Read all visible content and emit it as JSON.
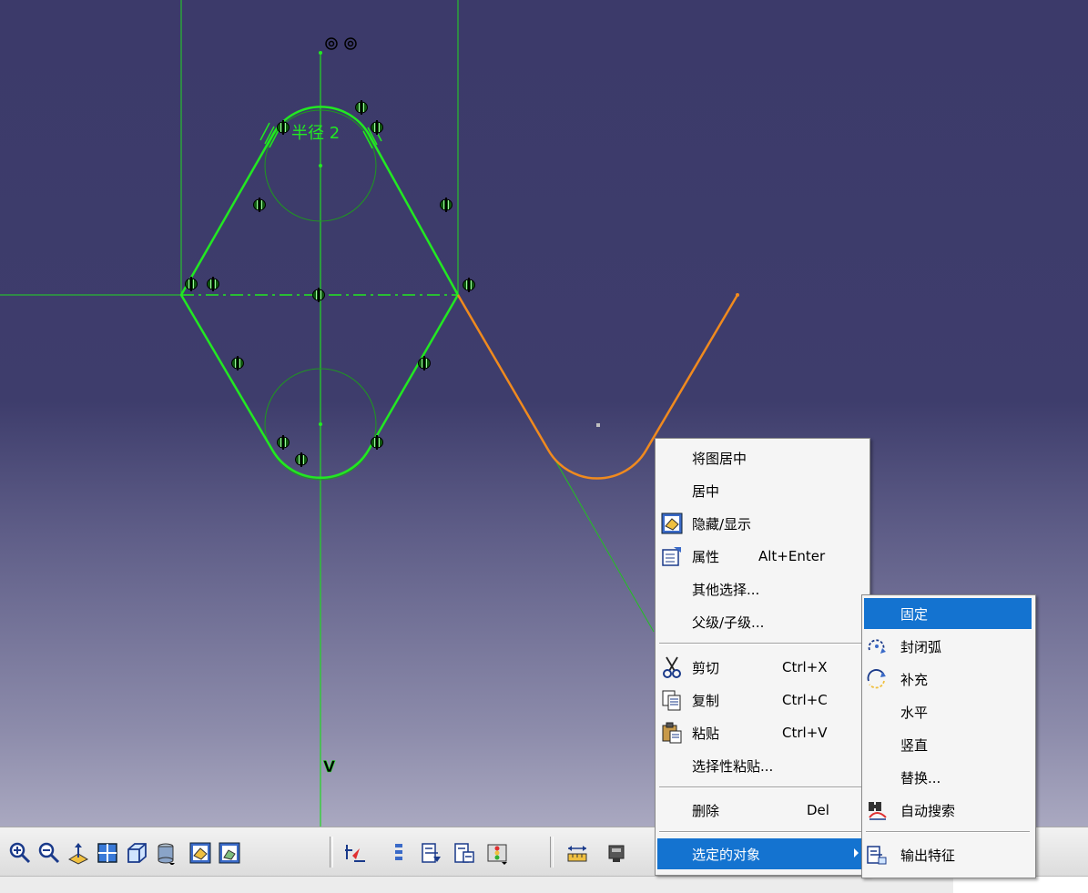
{
  "sketch": {
    "constraint_label": "半径 2",
    "axis_label": "V",
    "colors": {
      "geometry": "#22e822",
      "construction": "#1ea81e",
      "selected_curve": "#f08a1e",
      "background_top": "#3c3a6a"
    }
  },
  "toolbar": {
    "icons": [
      "zoom-in-icon",
      "zoom-out-icon",
      "normal-view-icon",
      "multi-view-icon",
      "isometric-view-icon",
      "view-mode-icon",
      "hide-show-icon",
      "swap-visible-space-icon",
      "sketch-solve-status-icon",
      "sketch-analysis-icon",
      "constraint-icon",
      "auto-constraint-icon",
      "animate-constraint-icon",
      "measure-icon",
      "catalog-icon"
    ]
  },
  "context_menu": {
    "items": [
      {
        "label": "将图居中",
        "shortcut": "",
        "icon": ""
      },
      {
        "label": "居中",
        "shortcut": "",
        "icon": ""
      },
      {
        "label": "隐藏/显示",
        "shortcut": "",
        "icon": "hide-show-icon"
      },
      {
        "label": "属性",
        "shortcut": "Alt+Enter",
        "icon": "properties-icon"
      },
      {
        "label": "其他选择...",
        "shortcut": "",
        "icon": ""
      },
      {
        "label": "父级/子级...",
        "shortcut": "",
        "icon": ""
      },
      {
        "label": "剪切",
        "shortcut": "Ctrl+X",
        "icon": "scissors-icon"
      },
      {
        "label": "复制",
        "shortcut": "Ctrl+C",
        "icon": "copy-icon"
      },
      {
        "label": "粘贴",
        "shortcut": "Ctrl+V",
        "icon": "paste-icon"
      },
      {
        "label": "选择性粘贴...",
        "shortcut": "",
        "icon": ""
      },
      {
        "label": "删除",
        "shortcut": "Del",
        "icon": ""
      },
      {
        "label": "选定的对象",
        "shortcut": "",
        "icon": "submenu-arrow-icon"
      }
    ]
  },
  "submenu": {
    "items": [
      {
        "label": "固定",
        "icon": ""
      },
      {
        "label": "封闭弧",
        "icon": "close-arc-icon"
      },
      {
        "label": "补充",
        "icon": "complement-icon"
      },
      {
        "label": "水平",
        "icon": ""
      },
      {
        "label": "竖直",
        "icon": ""
      },
      {
        "label": "替换...",
        "icon": ""
      },
      {
        "label": "自动搜索",
        "icon": "auto-search-icon"
      },
      {
        "label": "输出特征",
        "icon": "output-feature-icon"
      }
    ]
  }
}
